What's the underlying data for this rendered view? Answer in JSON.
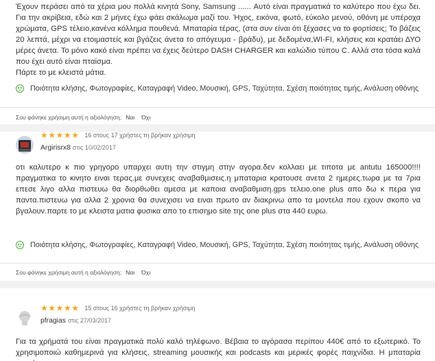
{
  "reviews": [
    {
      "text": "Έχουν περάσει από τα χέρια μου πολλά κινητά Sony, Samsung ...... Αυτό είναι πραγματικά το καλύτερο που έχω δει. Για την ακρίβεια, εδώ και 2 μήνες έχω φάει σκάλωμα μαζί του. Ήχος, εικόνα, φωτό, εύκολο μενού, οθόνη με υπέροχα χρώματα, GPS τέλειο,κανένα κόλλημα πουθενά. Μπαταρία τέρας, (στα συν είναι ότι ξέχασες να το φορτίσεις; Το βάζεις 20 λεπτά, μέχρι να ετοιμαστείς και βγάζεις άνετα το απόγευμα - βράδυ), με δεδομένα,WI-FI, κλήσεις και κρατάει ΔΥΟ μέρες άνετα. Το μόνο κακό είναι πρέπει να έχεις δεύτερο DASH CHARGER και καλώδιο τύπου C. Αλλά στα τόσα καλά που έχει αυτό είναι πταίσμα.\nΠάρτε το με κλειστά μάτια.",
      "pros": "Ποιότητα κλήσης, Φωτογραφίες, Καταγραφή Video, Μουσική, GPS, Ταχύτητα, Σχέση ποιότητας τιμής, Ανάλυση οθόνης",
      "helpful_question": "Σου φάνηκε χρήσιμη αυτή η αξιολόγηση;",
      "yes": "Ναι",
      "no": "Όχι"
    },
    {
      "rating": 5,
      "helpful_count": "16 στους 17 χρήστες τη βρήκαν χρήσιμη",
      "author": "Argirisrx8",
      "date": "στις 10/02/2017",
      "text": "οτι καλυτερο κ πιο γρηγορο υπαρχει αυτη την στιγμη στην αγορα.δεν κολλαει με τιποτα με antutu 165000!!!!πραγματικα το κινητο ειναι τερας.με συνεχεις αναβαθμισεις.η μπαταρια κρατουσε ανετα 2 ημερες.τωρα με τα 7ρια επεσε λιγο αλλα πιστευω θα διορθωθει αμεσα με καποια αναβαθμιση.gps τελειο.one plus απο δω κ περα για παντα.πιστευω για αλλα 2 χρονια θα συνεχισει να ειναι πρωτο αν διακρινω απο τα μοντελα που εχουν σκοπο να βγαλουν.παρτε το με κλειστα ματια φυσικα απο το επισημο site της one plus στα 440 ευρω.",
      "pros": "Ποιότητα κλήσης, Φωτογραφίες, Καταγραφή Video, Μουσική, GPS, Ταχύτητα, Σχέση ποιότητας τιμής, Ανάλυση οθόνης",
      "helpful_question": "Σου φάνηκε χρήσιμη αυτή η αξιολόγηση;",
      "yes": "Ναι",
      "no": "Όχι"
    },
    {
      "rating": 5,
      "helpful_count": "15 στους 16 χρήστες τη βρήκαν χρήσιμη",
      "author": "pfragias",
      "date": "στις 27/03/2017",
      "text": "Για τα χρήματά του είναι πραγματικά πολύ καλό τηλέφωνο. Βέβαια το αγόρασα περίπου 440€ από το εξωτερικό. Το χρησιμοποιώ καθημερινά για κλήσεις, streaming μουσικής και podcasts και μερικές φορές παιχνίδια. Η μπαταρία κρατάει"
    }
  ],
  "colors": {
    "star": "#f5a623",
    "pros_icon": "#48a93a",
    "divider": "#e4e4e4",
    "band": "#f2f2f2"
  }
}
